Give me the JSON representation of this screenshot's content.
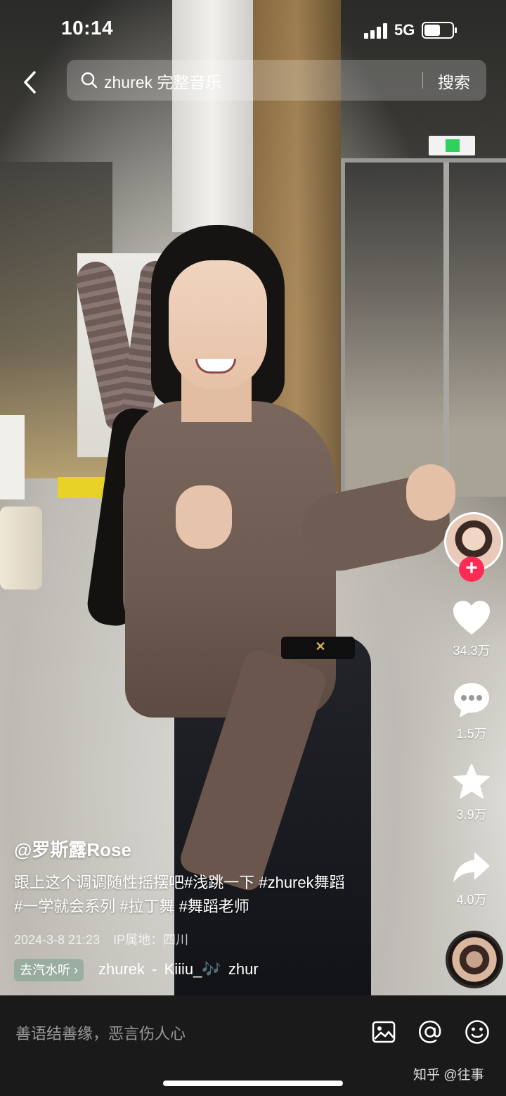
{
  "status_bar": {
    "time": "10:14",
    "network": "5G"
  },
  "search": {
    "query": "zhurek 完整音乐",
    "button_label": "搜索"
  },
  "actions": {
    "likes": "34.3万",
    "comments": "1.5万",
    "favorites": "3.9万",
    "shares": "4.0万"
  },
  "post": {
    "author": "@罗斯露Rose",
    "description_line1": "跟上这个调调随性摇摆吧#浅跳一下 #zhurek舞蹈",
    "description_line2": "#一学就会系列 #拉丁舞 #舞蹈老师",
    "date": "2024-3-8 21:23",
    "ip_location": "IP属地：四川",
    "soda_chip": "去汽水听",
    "music": "zhurek - Kiiiu_🎶   zhur"
  },
  "comment_bar": {
    "placeholder": "善语结善缘，恶言伤人心"
  },
  "watermark": "知乎 @往事",
  "colors": {
    "accent_red": "#fe2c55",
    "bottom_bar": "#1a1a1a"
  }
}
